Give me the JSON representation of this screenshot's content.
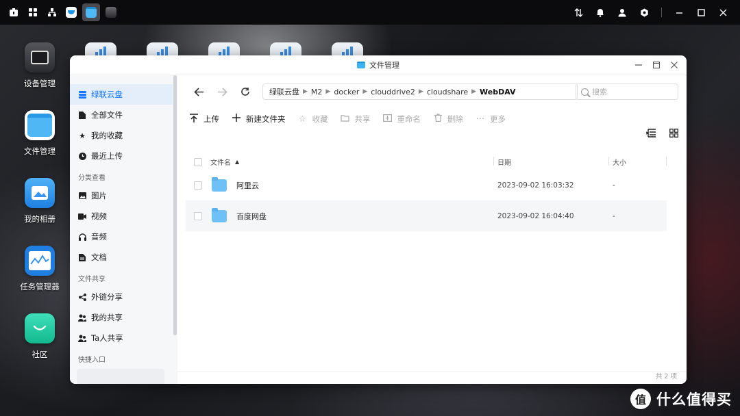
{
  "taskbar": {
    "right_icons": [
      "sort-icon",
      "bell-icon",
      "user-icon",
      "settings-icon"
    ],
    "window_controls": [
      "minimize-icon",
      "maximize-icon",
      "close-icon"
    ]
  },
  "desktop": {
    "icons": [
      {
        "label": "设备管理",
        "icon": "device-manager-icon"
      },
      {
        "label": "文件管理",
        "icon": "file-manager-icon"
      },
      {
        "label": "我的相册",
        "icon": "photos-icon"
      },
      {
        "label": "任务管理器",
        "icon": "task-manager-icon"
      },
      {
        "label": "社区",
        "icon": "community-icon"
      }
    ]
  },
  "window": {
    "title": "文件管理"
  },
  "sidebar": {
    "items_top": [
      {
        "label": "绿联云盘",
        "icon": "cloud-drive-icon",
        "active": true
      },
      {
        "label": "全部文件",
        "icon": "file-icon"
      },
      {
        "label": "我的收藏",
        "icon": "star-icon"
      },
      {
        "label": "最近上传",
        "icon": "clock-icon"
      }
    ],
    "section_category": "分类查看",
    "items_category": [
      {
        "label": "图片",
        "icon": "image-icon"
      },
      {
        "label": "视频",
        "icon": "video-icon"
      },
      {
        "label": "音频",
        "icon": "headphones-icon"
      },
      {
        "label": "文档",
        "icon": "document-icon"
      }
    ],
    "section_share": "文件共享",
    "items_share": [
      {
        "label": "外链分享",
        "icon": "share-icon"
      },
      {
        "label": "我的共享",
        "icon": "users-icon"
      },
      {
        "label": "Ta人共享",
        "icon": "users-icon"
      }
    ],
    "section_quick": "快捷入口"
  },
  "breadcrumb": [
    "绿联云盘",
    "M2",
    "docker",
    "clouddrive2",
    "cloudshare",
    "WebDAV"
  ],
  "search": {
    "placeholder": "搜索"
  },
  "toolbar": {
    "upload": "上传",
    "new_folder": "新建文件夹",
    "favorite": "收藏",
    "share": "共享",
    "rename": "重命名",
    "delete": "删除",
    "more": "更多"
  },
  "table": {
    "headers": {
      "name": "文件名",
      "date": "日期",
      "size": "大小"
    },
    "rows": [
      {
        "name": "阿里云",
        "date": "2023-09-02 16:03:32",
        "size": "-"
      },
      {
        "name": "百度网盘",
        "date": "2023-09-02 16:04:40",
        "size": "-"
      }
    ]
  },
  "status": {
    "count": "共 2 项"
  },
  "watermark": {
    "symbol": "值",
    "text": "什么值得买"
  }
}
